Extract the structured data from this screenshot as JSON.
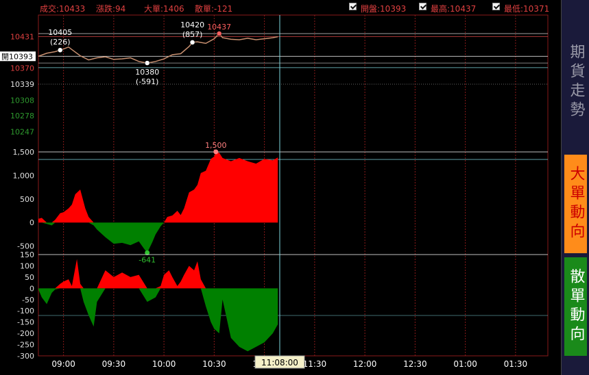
{
  "header": {
    "trade_label": "成交:10433",
    "change_label": "漲跌:94",
    "big_order_label": "大單:1406",
    "small_order_label": "散單:-121",
    "open_label": "開盤:10393",
    "high_label": "最高:10437",
    "low_label": "最低:10371"
  },
  "sidebar": {
    "items": [
      {
        "label": "期貨走勢",
        "color": "#9a9aa8",
        "bg": "#1a1a3a"
      },
      {
        "label": "大單動向",
        "color": "#cc0000",
        "bg": "#ff8c1a"
      },
      {
        "label": "散單動向",
        "color": "#ffffff",
        "bg": "#1a8a1a"
      }
    ]
  },
  "colors": {
    "up": "#ff0000",
    "down": "#008000",
    "price_line": "#c89070",
    "cursor": "#7fd8e0",
    "grid_red": "#8a1a1a",
    "up_tick": "#e04040",
    "down_tick": "#2e9a2e"
  },
  "chart_data": [
    {
      "type": "line",
      "title": "期貨走勢",
      "open_marker": "開10393",
      "y_ticks": [
        10431,
        10393,
        10370,
        10339,
        10308,
        10278,
        10247
      ],
      "up_ticks": [
        10431,
        10370
      ],
      "neutral_ticks": [
        10339
      ],
      "down_ticks": [
        10308,
        10278,
        10247
      ],
      "ylim": [
        10237,
        10449
      ],
      "x_ticks": [
        "09:00",
        "09:30",
        "10:00",
        "10:30",
        "11:00",
        "11:30",
        "12:00",
        "12:30",
        "01:00",
        "01:30"
      ],
      "cursor_time": "11:08:00",
      "annotations": [
        {
          "price": "10405",
          "vol": "(226)",
          "x": "08:58",
          "y": 10405
        },
        {
          "price": "10420",
          "vol": "(857)",
          "x": "10:17",
          "y": 10420
        },
        {
          "price": "10437",
          "vol": "",
          "x": "10:33",
          "y": 10437
        },
        {
          "price": "10380",
          "vol": "(-591)",
          "x": "09:50",
          "y": 10380
        }
      ],
      "series": [
        {
          "x": [
            "08:45",
            "08:50",
            "08:55",
            "08:58",
            "09:00",
            "09:03",
            "09:05",
            "09:10",
            "09:15",
            "09:20",
            "09:25",
            "09:30",
            "09:35",
            "09:40",
            "09:45",
            "09:50",
            "09:55",
            "10:00",
            "10:05",
            "10:10",
            "10:15",
            "10:17",
            "10:20",
            "10:25",
            "10:30",
            "10:33",
            "10:35",
            "10:40",
            "10:45",
            "10:50",
            "10:55",
            "11:00",
            "11:05",
            "11:08"
          ],
          "y": [
            10393,
            10399,
            10402,
            10405,
            10407,
            10411,
            10406,
            10394,
            10386,
            10390,
            10392,
            10387,
            10388,
            10390,
            10383,
            10380,
            10383,
            10388,
            10396,
            10398,
            10412,
            10420,
            10421,
            10418,
            10427,
            10437,
            10429,
            10426,
            10425,
            10428,
            10425,
            10427,
            10429,
            10431
          ]
        }
      ]
    },
    {
      "type": "area",
      "title": "大單動向",
      "y_ticks": [
        "1,500",
        "1,000",
        "500",
        "0",
        "-500"
      ],
      "ylim": [
        -650,
        1600
      ],
      "peak": {
        "label": "1,500",
        "x": "10:31",
        "y": 1500
      },
      "trough": {
        "label": "-641",
        "x": "09:50",
        "y": -641
      },
      "series": [
        {
          "x": [
            "08:45",
            "08:47",
            "08:50",
            "08:53",
            "08:55",
            "08:58",
            "09:00",
            "09:03",
            "09:05",
            "09:07",
            "09:10",
            "09:13",
            "09:15",
            "09:18",
            "09:20",
            "09:25",
            "09:30",
            "09:35",
            "09:40",
            "09:45",
            "09:48",
            "09:50",
            "09:53",
            "09:55",
            "09:58",
            "10:00",
            "10:02",
            "10:05",
            "10:08",
            "10:10",
            "10:12",
            "10:15",
            "10:18",
            "10:20",
            "10:22",
            "10:25",
            "10:28",
            "10:30",
            "10:31",
            "10:33",
            "10:35",
            "10:40",
            "10:45",
            "10:50",
            "10:55",
            "11:00",
            "11:05",
            "11:08"
          ],
          "y": [
            80,
            100,
            -30,
            -60,
            60,
            200,
            220,
            300,
            380,
            600,
            700,
            300,
            120,
            -60,
            -150,
            -310,
            -450,
            -430,
            -480,
            -400,
            -550,
            -641,
            -420,
            -250,
            -80,
            0,
            120,
            150,
            250,
            160,
            300,
            640,
            700,
            800,
            1050,
            1100,
            1350,
            1400,
            1500,
            1480,
            1370,
            1300,
            1370,
            1300,
            1250,
            1350,
            1320,
            1380
          ]
        }
      ]
    },
    {
      "type": "area",
      "title": "散單動向",
      "y_ticks": [
        "150",
        "100",
        "50",
        "0",
        "-50",
        "-100",
        "-150",
        "-200",
        "-250",
        "-300"
      ],
      "ylim": [
        -300,
        150
      ],
      "series": [
        {
          "x": [
            "08:45",
            "08:47",
            "08:50",
            "08:53",
            "08:55",
            "08:58",
            "09:00",
            "09:03",
            "09:05",
            "09:08",
            "09:10",
            "09:12",
            "09:15",
            "09:18",
            "09:20",
            "09:25",
            "09:30",
            "09:35",
            "09:40",
            "09:45",
            "09:50",
            "09:55",
            "09:58",
            "10:00",
            "10:03",
            "10:05",
            "10:08",
            "10:10",
            "10:12",
            "10:15",
            "10:18",
            "10:20",
            "10:22",
            "10:25",
            "10:28",
            "10:30",
            "10:33",
            "10:35",
            "10:40",
            "10:45",
            "10:50",
            "10:55",
            "11:00",
            "11:05",
            "11:08"
          ],
          "y": [
            -5,
            -40,
            -70,
            -20,
            -5,
            20,
            30,
            40,
            10,
            130,
            20,
            -60,
            -120,
            -170,
            -60,
            80,
            50,
            70,
            50,
            60,
            -60,
            -40,
            10,
            60,
            80,
            50,
            10,
            30,
            60,
            100,
            80,
            120,
            40,
            -80,
            -150,
            -180,
            -200,
            -50,
            -220,
            -260,
            -280,
            -260,
            -240,
            -200,
            -160
          ]
        }
      ]
    }
  ]
}
